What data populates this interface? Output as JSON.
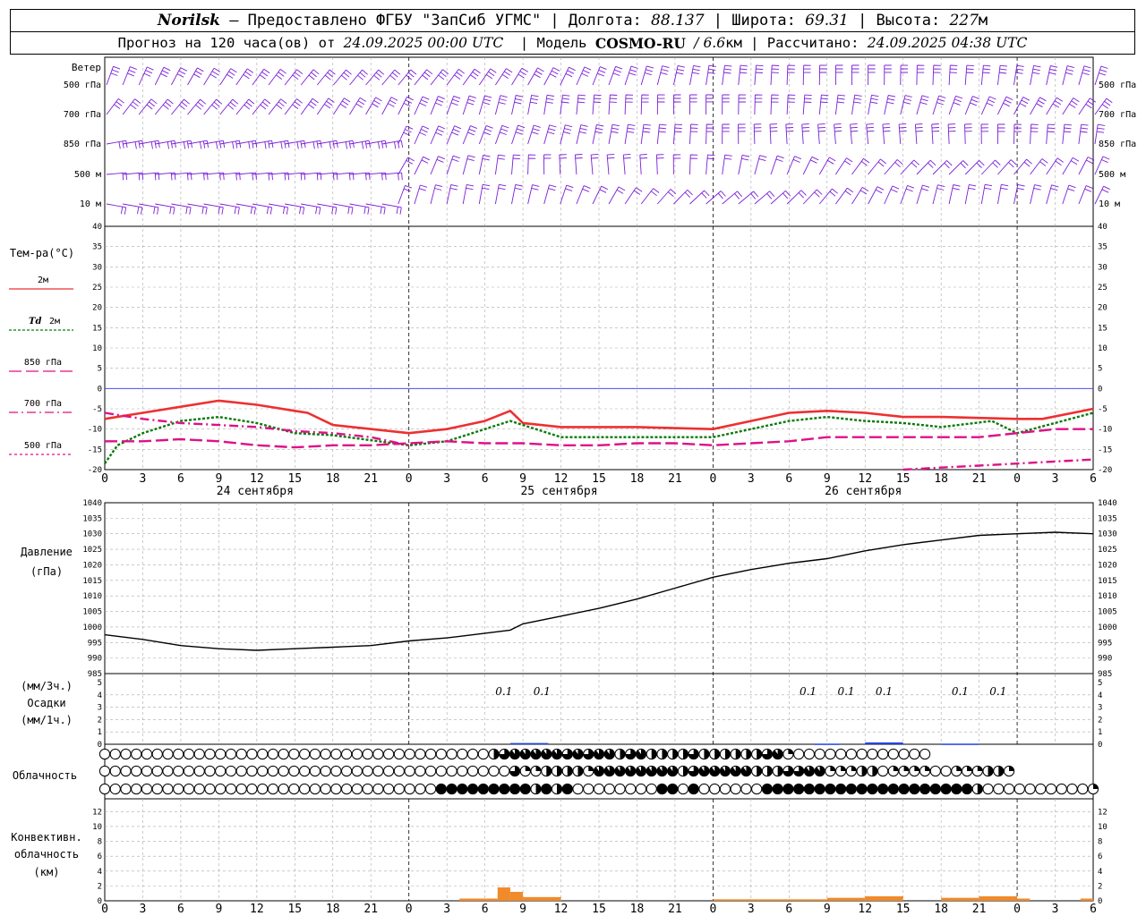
{
  "header": {
    "station": "Norilsk",
    "provider": "– Предоставлено ФГБУ \"ЗапСиб УГМС\" |",
    "lon_label": "Долгота:",
    "lon": "88.137",
    "lat_label": "| Широта:",
    "lat": "69.31",
    "alt_label": "| Высота:",
    "alt": "227",
    "alt_unit": "м",
    "forecast_label": "Прогноз на 120 часа(ов) от",
    "forecast_start": "24.09.2025 00:00 UTC",
    "model_label": "| Модель",
    "model": "COSMO-RU",
    "resolution": "/ 6.6",
    "resolution_unit": "км",
    "computed_label": "| Рассчитано:",
    "computed": "24.09.2025 04:38 UTC"
  },
  "wind_panel": {
    "title": "Ветер",
    "levels": [
      "500 гПа",
      "700 гПа",
      "850 гПа",
      "500 м",
      "10  м"
    ],
    "color": "#7a1fd6"
  },
  "temp_panel": {
    "title": "Тем-ра(°C)",
    "legend": [
      {
        "prefix": "",
        "label": "2м",
        "color": "#ee3030",
        "dash": ""
      },
      {
        "prefix": "Td",
        "label": "2м",
        "color": "#0a7a0a",
        "dash": "3,2"
      },
      {
        "prefix": "",
        "label": "850 гПа",
        "color": "#dd1188",
        "dash": "14,5"
      },
      {
        "prefix": "",
        "label": "700 гПа",
        "color": "#dd1188",
        "dash": "10,4,2,4"
      },
      {
        "prefix": "",
        "label": "500 гПа",
        "color": "#dd1188",
        "dash": "3,3"
      }
    ]
  },
  "pressure_panel": {
    "title": "Давление",
    "unit": "(гПа)"
  },
  "precip_panel": {
    "unit_top": "(мм/3ч.)",
    "title": "Осадки",
    "unit_bottom": "(мм/1ч.)"
  },
  "cloud_panel": {
    "title": "Облачность"
  },
  "conv_panel": {
    "title_1": "Конвективн.",
    "title_2": "облачность",
    "unit": "(км)"
  },
  "days": [
    "24 сентября",
    "25 сентября",
    "26 сентября"
  ],
  "x_tick_labels": [
    "0",
    "3",
    "6",
    "9",
    "12",
    "15",
    "18",
    "21",
    "0",
    "3",
    "6",
    "9",
    "12",
    "15",
    "18",
    "21",
    "0",
    "3",
    "6",
    "9",
    "12",
    "15",
    "18",
    "21",
    "0",
    "3",
    "6"
  ],
  "chart_data": {
    "type": "line",
    "x_unit": "hours since 24.09.2025 00:00 UTC",
    "x_range": [
      0,
      78
    ],
    "temperature": {
      "ylim": [
        -20,
        40
      ],
      "ticks": [
        -20,
        -15,
        -10,
        -5,
        0,
        5,
        10,
        15,
        20,
        25,
        30,
        35,
        40
      ],
      "series": [
        {
          "name": "2м",
          "x": [
            0,
            3,
            6,
            9,
            12,
            15,
            16,
            18,
            24,
            27,
            30,
            32,
            33,
            36,
            42,
            48,
            51,
            54,
            57,
            60,
            63,
            66,
            72,
            74,
            78
          ],
          "y": [
            -7.5,
            -6,
            -4.5,
            -3,
            -4,
            -5.5,
            -6,
            -9,
            -11,
            -10,
            -8,
            -5.5,
            -8.5,
            -9.5,
            -9.5,
            -10,
            -8,
            -6,
            -5.5,
            -6,
            -7,
            -7,
            -7.5,
            -7.5,
            -5
          ]
        },
        {
          "name": "Td 2м",
          "x": [
            0,
            1,
            3,
            6,
            9,
            12,
            15,
            18,
            24,
            27,
            30,
            32,
            33,
            36,
            42,
            48,
            51,
            54,
            57,
            60,
            63,
            66,
            70,
            72,
            78
          ],
          "y": [
            -18.5,
            -14,
            -11,
            -8,
            -7,
            -8.5,
            -11,
            -11.5,
            -14,
            -13,
            -10,
            -8,
            -9,
            -12,
            -12,
            -12,
            -10,
            -8,
            -7,
            -8,
            -8.5,
            -9.5,
            -8,
            -11,
            -6
          ]
        },
        {
          "name": "850 гПа",
          "x": [
            0,
            3,
            6,
            9,
            12,
            15,
            18,
            21,
            24,
            27,
            30,
            33,
            36,
            39,
            42,
            45,
            48,
            51,
            54,
            57,
            60,
            63,
            66,
            69,
            72,
            75,
            78
          ],
          "y": [
            -13,
            -13,
            -12.5,
            -13,
            -14,
            -14.5,
            -14,
            -14,
            -13.5,
            -13,
            -13.5,
            -13.5,
            -14,
            -14,
            -13.5,
            -13.5,
            -14,
            -13.5,
            -13,
            -12,
            -12,
            -12,
            -12,
            -12,
            -11,
            -10,
            -10
          ]
        },
        {
          "name": "700 гПа",
          "x": [
            0,
            3,
            6,
            9,
            12,
            15,
            18,
            21,
            24,
            27,
            63,
            66,
            69,
            72,
            75,
            78
          ],
          "y": [
            -6,
            -7.5,
            -8.5,
            -9,
            -9.5,
            -10.5,
            -11,
            -12,
            -14,
            -20.5,
            -20,
            -19.5,
            -19,
            -18.5,
            -18,
            -17.5
          ]
        }
      ]
    },
    "pressure": {
      "ylim": [
        985,
        1040
      ],
      "ticks": [
        985,
        990,
        995,
        1000,
        1005,
        1010,
        1015,
        1020,
        1025,
        1030,
        1035,
        1040
      ],
      "x": [
        0,
        3,
        6,
        9,
        12,
        15,
        18,
        21,
        24,
        27,
        30,
        32,
        33,
        36,
        39,
        42,
        45,
        48,
        51,
        54,
        57,
        60,
        63,
        66,
        69,
        72,
        75,
        78
      ],
      "y": [
        997.5,
        996,
        994,
        993,
        992.5,
        993,
        993.5,
        994,
        995.5,
        996.5,
        998,
        999,
        1001,
        1003.5,
        1006,
        1009,
        1012.5,
        1016,
        1018.5,
        1020.5,
        1022,
        1024.5,
        1026.5,
        1028,
        1029.5,
        1030,
        1030.5,
        1030
      ]
    },
    "precipitation": {
      "ylim": [
        0,
        5
      ],
      "ticks": [
        0,
        1,
        2,
        3,
        4,
        5
      ],
      "labels": [
        {
          "x": 31.5,
          "text": "0.1"
        },
        {
          "x": 34.5,
          "text": "0.1"
        },
        {
          "x": 55.5,
          "text": "0.1"
        },
        {
          "x": 58.5,
          "text": "0.1"
        },
        {
          "x": 61.5,
          "text": "0.1"
        },
        {
          "x": 67.5,
          "text": "0.1"
        },
        {
          "x": 70.5,
          "text": "0.1"
        }
      ],
      "bars": [
        {
          "x0": 32,
          "x1": 35,
          "value": 0.1
        },
        {
          "x0": 56,
          "x1": 58,
          "value": 0.05
        },
        {
          "x0": 60,
          "x1": 63,
          "value": 0.15
        },
        {
          "x0": 66,
          "x1": 69,
          "value": 0.05
        }
      ]
    },
    "cloud_cover_tenths": {
      "rows": [
        "high",
        "middle",
        "low"
      ],
      "high": [
        0,
        0,
        0,
        0,
        0,
        0,
        0,
        0,
        0,
        0,
        0,
        0,
        0,
        0,
        0,
        0,
        0,
        0,
        0,
        0,
        0,
        0,
        0,
        0,
        0,
        0,
        0,
        0,
        0,
        0,
        0,
        0,
        0,
        0,
        0,
        0,
        0,
        5,
        7,
        9,
        9,
        9,
        9,
        9,
        7,
        9,
        7,
        9,
        9,
        5,
        7,
        9,
        5,
        5,
        5,
        5,
        7,
        5,
        5,
        5,
        5,
        5,
        5,
        7,
        9,
        3,
        0,
        0,
        0,
        0,
        0,
        0,
        0,
        0,
        0,
        0,
        0,
        0,
        0
      ],
      "middle": [
        0,
        0,
        0,
        0,
        0,
        0,
        0,
        0,
        0,
        0,
        0,
        0,
        0,
        0,
        0,
        0,
        0,
        0,
        0,
        0,
        0,
        0,
        0,
        0,
        0,
        0,
        0,
        0,
        0,
        0,
        0,
        0,
        0,
        0,
        0,
        0,
        0,
        0,
        0,
        7,
        3,
        3,
        5,
        5,
        5,
        5,
        3,
        9,
        9,
        9,
        9,
        9,
        9,
        9,
        9,
        5,
        7,
        9,
        9,
        9,
        9,
        9,
        5,
        5,
        5,
        7,
        7,
        9,
        9,
        3,
        3,
        3,
        5,
        5,
        0,
        3,
        3,
        3,
        3,
        0,
        0,
        3,
        3,
        3,
        5,
        5,
        3
      ],
      "low": [
        0,
        0,
        0,
        0,
        0,
        0,
        0,
        0,
        0,
        0,
        0,
        0,
        0,
        0,
        0,
        0,
        0,
        0,
        0,
        0,
        0,
        0,
        0,
        0,
        0,
        0,
        0,
        0,
        0,
        0,
        0,
        0,
        10,
        10,
        10,
        10,
        10,
        10,
        10,
        10,
        10,
        5,
        10,
        5,
        10,
        0,
        0,
        0,
        0,
        0,
        0,
        0,
        0,
        10,
        10,
        0,
        10,
        0,
        0,
        0,
        0,
        0,
        0,
        10,
        10,
        10,
        10,
        10,
        10,
        10,
        10,
        10,
        10,
        10,
        10,
        10,
        10,
        10,
        10,
        10,
        10,
        10,
        10,
        5,
        0,
        0,
        0,
        0,
        0,
        0,
        0,
        0,
        0,
        0,
        3
      ]
    },
    "convective_cloud": {
      "ylim": [
        0,
        13
      ],
      "ticks": [
        0,
        2,
        4,
        6,
        8,
        10,
        12
      ],
      "bars": [
        {
          "x0": 28,
          "x1": 31,
          "value": 0.3
        },
        {
          "x0": 31,
          "x1": 32,
          "value": 1.8
        },
        {
          "x0": 32,
          "x1": 33,
          "value": 1.2
        },
        {
          "x0": 33,
          "x1": 36,
          "value": 0.5
        },
        {
          "x0": 48,
          "x1": 57,
          "value": 0.2
        },
        {
          "x0": 57,
          "x1": 60,
          "value": 0.4
        },
        {
          "x0": 60,
          "x1": 63,
          "value": 0.6
        },
        {
          "x0": 66,
          "x1": 69,
          "value": 0.4
        },
        {
          "x0": 69,
          "x1": 72,
          "value": 0.6
        },
        {
          "x0": 72,
          "x1": 73,
          "value": 0.3
        },
        {
          "x0": 77,
          "x1": 78,
          "value": 0.3
        }
      ]
    }
  }
}
